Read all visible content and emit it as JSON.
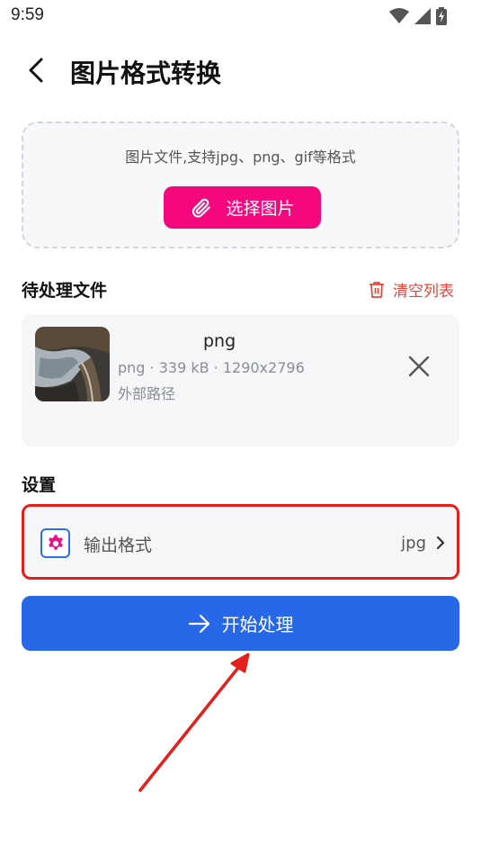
{
  "status_bar": {
    "time": "9:59",
    "icons": [
      "wifi-icon",
      "signal-icon",
      "battery-charging-icon"
    ]
  },
  "header": {
    "title": "图片格式转换",
    "back_icon": "chevron-left-icon"
  },
  "upload": {
    "hint": "图片文件,支持jpg、png、gif等格式",
    "button_label": "选择图片",
    "button_icon": "paperclip-icon",
    "accent_color": "#f5087d"
  },
  "pending": {
    "title": "待处理文件",
    "clear_label": "清空列表",
    "clear_icon": "trash-icon",
    "clear_color": "#e8443c",
    "files": [
      {
        "name": "png",
        "meta": "png · 339 kB · 1290x2796",
        "path": "外部路径",
        "remove_icon": "close-icon"
      }
    ]
  },
  "settings": {
    "title": "设置",
    "output_format": {
      "label": "输出格式",
      "value": "jpg",
      "icon": "gear-icon",
      "chevron_icon": "chevron-right-icon"
    }
  },
  "start": {
    "label": "开始处理",
    "icon": "arrow-right-icon",
    "color": "#2767e8"
  },
  "annotation": {
    "color": "#e3201b"
  }
}
